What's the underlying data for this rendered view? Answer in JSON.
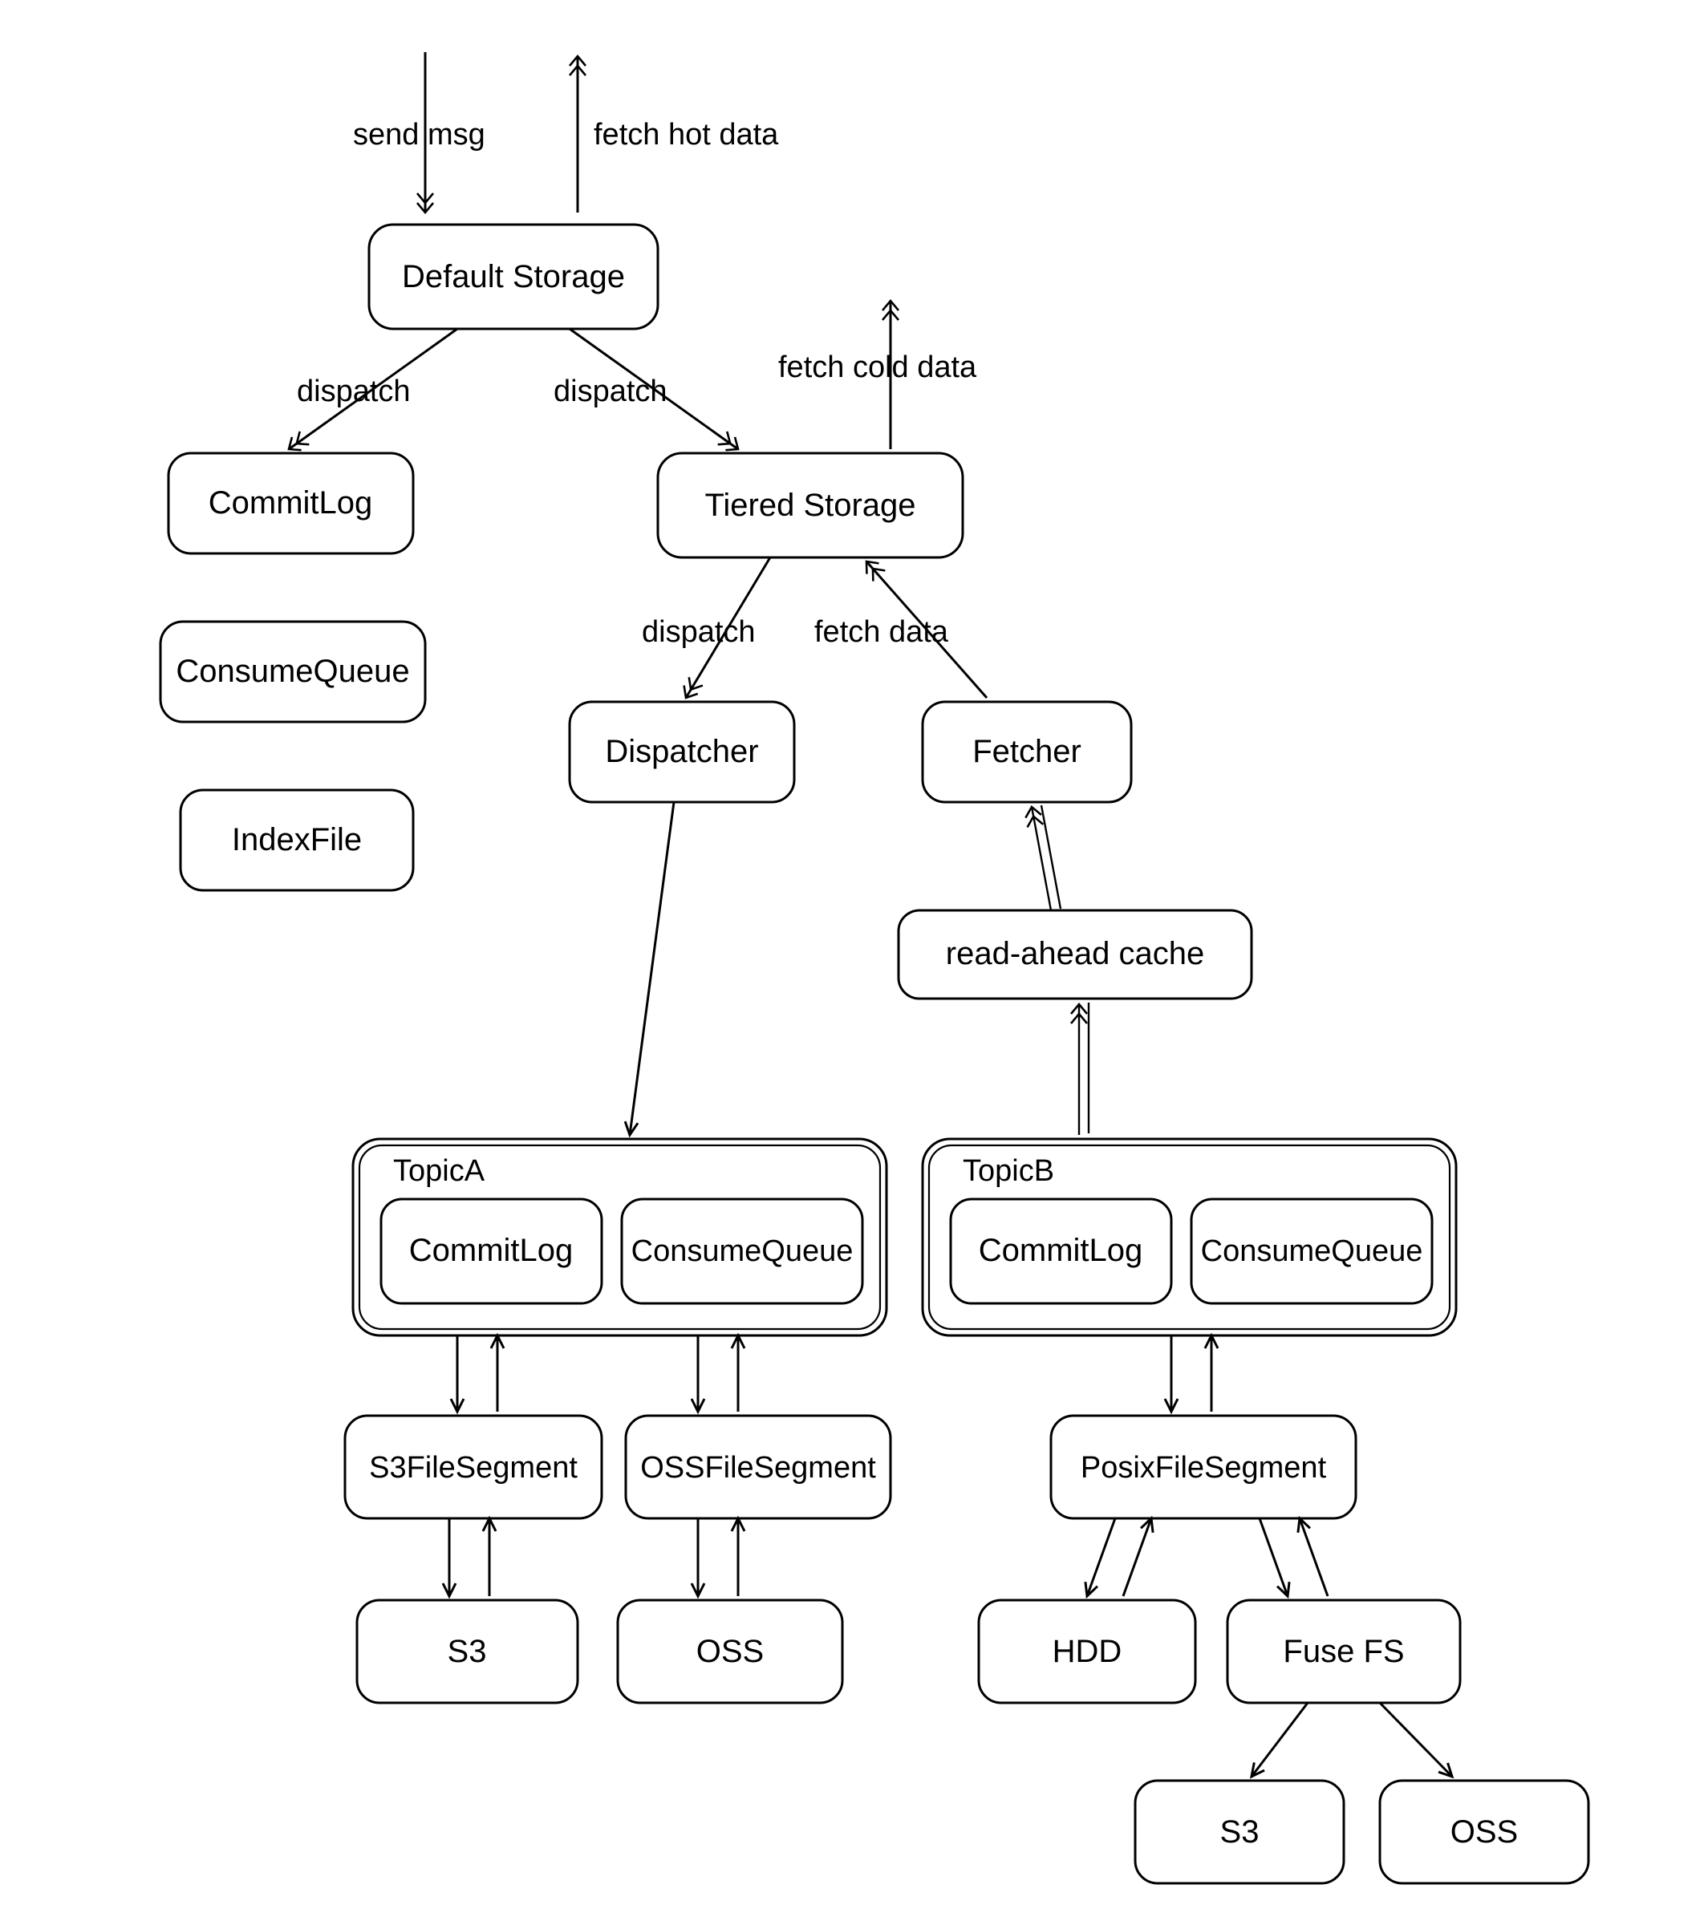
{
  "labels": {
    "send_msg": "send msg",
    "fetch_hot": "fetch hot data",
    "default_storage": "Default Storage",
    "dispatch_l": "dispatch",
    "dispatch_r": "dispatch",
    "fetch_cold": "fetch cold data",
    "commitlog": "CommitLog",
    "tiered_storage": "Tiered Storage",
    "consumequeue": "ConsumeQueue",
    "indexfile": "IndexFile",
    "dispatch_ts": "dispatch",
    "fetch_data_ts": "fetch data",
    "dispatcher": "Dispatcher",
    "fetcher": "Fetcher",
    "read_ahead": "read-ahead cache",
    "topicA": "TopicA",
    "topicA_cl": "CommitLog",
    "topicA_cq": "ConsumeQueue",
    "topicB": "TopicB",
    "topicB_cl": "CommitLog",
    "topicB_cq": "ConsumeQueue",
    "s3seg": "S3FileSegment",
    "ossseg": "OSSFileSegment",
    "posixseg": "PosixFileSegment",
    "s3": "S3",
    "oss": "OSS",
    "hdd": "HDD",
    "fusefs": "Fuse FS",
    "s3_b": "S3",
    "oss_b": "OSS"
  }
}
